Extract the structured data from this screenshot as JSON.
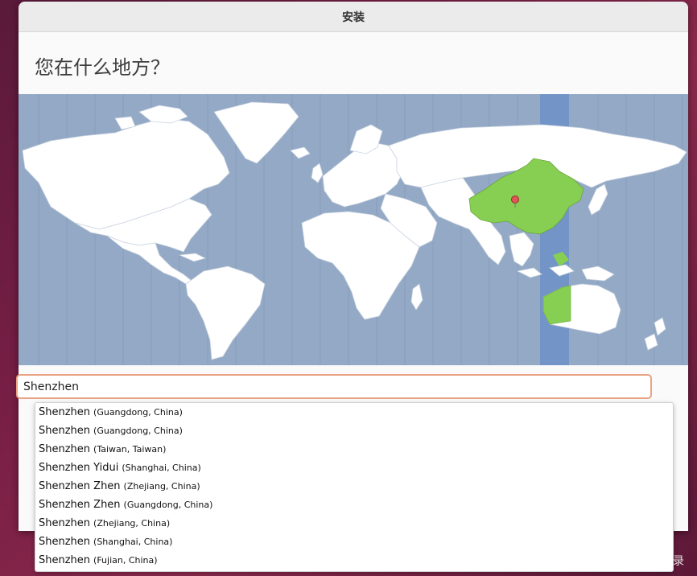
{
  "window": {
    "title": "安装"
  },
  "heading": "您在什么地方？",
  "map": {
    "ocean_color": "#93a9c6",
    "land_color": "#ffffff",
    "selected_region_color": "#87cf52",
    "timezone_band_color": "#7394c6",
    "pin_color": "#e05555"
  },
  "search": {
    "value": "Shenzhen"
  },
  "suggestions": [
    {
      "place": "Shenzhen",
      "region": "(Guangdong, China)"
    },
    {
      "place": "Shenzhen",
      "region": "(Guangdong, China)"
    },
    {
      "place": "Shenzhen",
      "region": "(Taiwan, Taiwan)"
    },
    {
      "place": "Shenzhen Yidui",
      "region": "(Shanghai, China)"
    },
    {
      "place": "Shenzhen Zhen",
      "region": "(Zhejiang, China)"
    },
    {
      "place": "Shenzhen Zhen",
      "region": "(Guangdong, China)"
    },
    {
      "place": "Shenzhen",
      "region": "(Zhejiang, China)"
    },
    {
      "place": "Shenzhen",
      "region": "(Shanghai, China)"
    },
    {
      "place": "Shenzhen",
      "region": "(Fujian, China)"
    }
  ],
  "watermark": "CSDN @容.CAI.录"
}
